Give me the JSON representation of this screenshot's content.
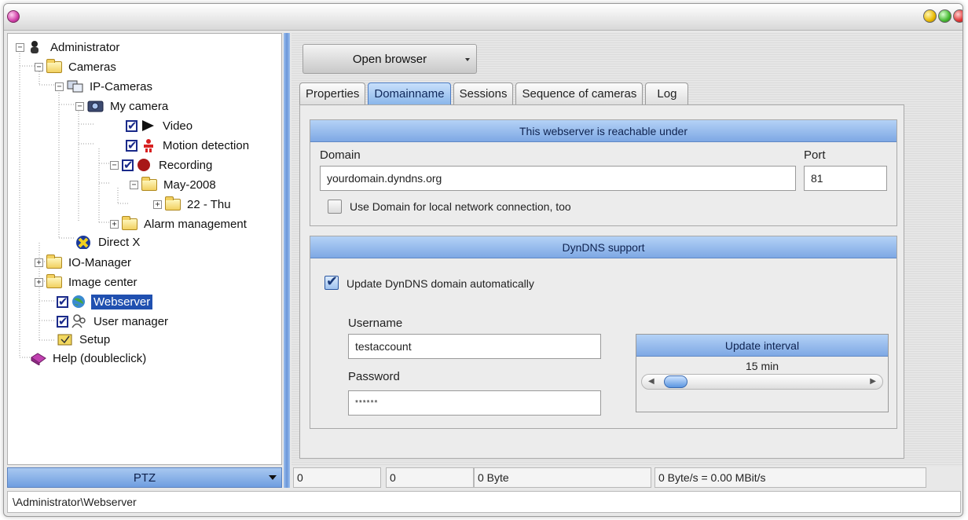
{
  "tree": {
    "administrator": "Administrator",
    "cameras": "Cameras",
    "ip_cameras": "IP-Cameras",
    "my_camera": "My camera",
    "video": "Video",
    "motion_detection": "Motion detection",
    "recording": "Recording",
    "may_2008": "May-2008",
    "day_22": "22 - Thu",
    "alarm_management": "Alarm management",
    "direct_x": "Direct X",
    "io_manager": "IO-Manager",
    "image_center": "Image center",
    "webserver": "Webserver",
    "user_manager": "User manager",
    "setup": "Setup",
    "help": "Help (doubleclick)"
  },
  "ptz": {
    "label": "PTZ"
  },
  "toolbar": {
    "open_browser": "Open browser"
  },
  "tabs": [
    {
      "label": "Properties",
      "active": false
    },
    {
      "label": "Domainname",
      "active": true
    },
    {
      "label": "Sessions",
      "active": false
    },
    {
      "label": "Sequence of cameras",
      "active": false
    },
    {
      "label": "Log",
      "active": false
    }
  ],
  "reachable": {
    "header": "This webserver is reachable under",
    "domain_label": "Domain",
    "domain_value": "yourdomain.dyndns.org",
    "port_label": "Port",
    "port_value": "81",
    "local_checkbox_label": "Use Domain for local network connection, too",
    "local_checked": false
  },
  "dyndns": {
    "header": "DynDNS support",
    "auto_update_label": "Update DynDNS domain automatically",
    "auto_update_checked": true,
    "username_label": "Username",
    "username_value": "testaccount",
    "password_label": "Password",
    "password_value": "******",
    "interval_header": "Update interval",
    "interval_value": "15 min",
    "interval_fraction": 0.0
  },
  "status": {
    "cell1": "0",
    "cell2": "0",
    "cell3": "0 Byte",
    "cell4": "0 Byte/s = 0.00 MBit/s"
  },
  "path_bar": {
    "path": "\\Administrator\\Webserver"
  },
  "colors": {
    "accent_blue": "#7ea8e4",
    "selection": "#2050b0",
    "check_blue": "#1a2a8a"
  }
}
